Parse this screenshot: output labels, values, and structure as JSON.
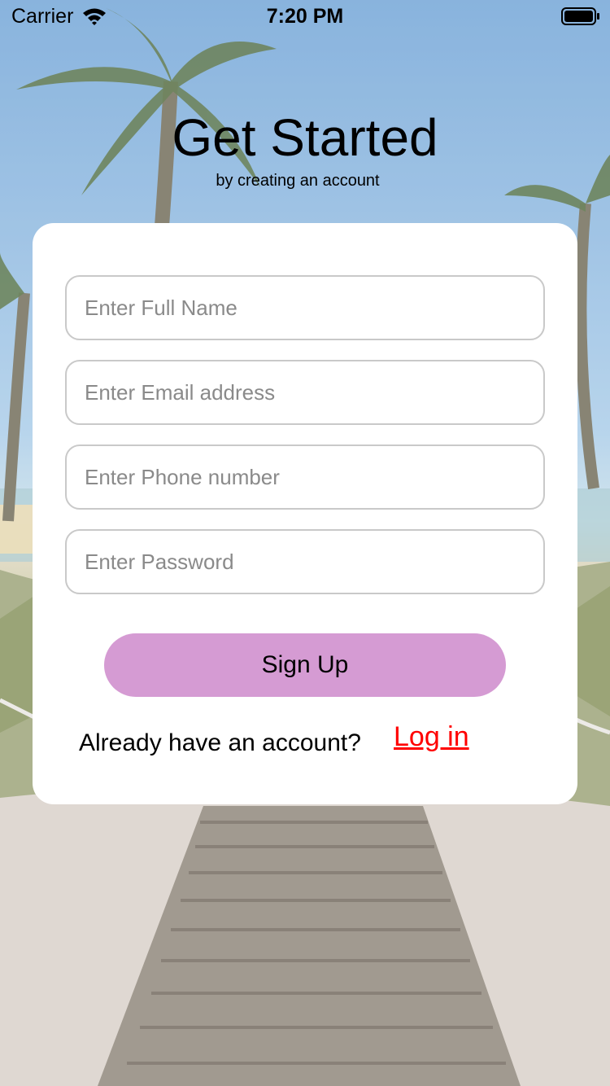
{
  "status_bar": {
    "carrier": "Carrier",
    "time": "7:20 PM",
    "wifi_icon": "wifi-icon",
    "battery_icon": "battery-full-icon"
  },
  "header": {
    "title": "Get Started",
    "subtitle": "by creating an account"
  },
  "form": {
    "fields": [
      {
        "placeholder": "Enter Full Name",
        "value": ""
      },
      {
        "placeholder": "Enter Email address",
        "value": ""
      },
      {
        "placeholder": "Enter Phone number",
        "value": ""
      },
      {
        "placeholder": "Enter Password",
        "value": ""
      }
    ],
    "signup_label": "Sign Up",
    "login_prompt": "Already have an account?",
    "login_link": "Log in"
  },
  "colors": {
    "button": "#d59bd3",
    "link": "#ff0000",
    "card": "#ffffff",
    "field_border": "#c9c9c9"
  }
}
